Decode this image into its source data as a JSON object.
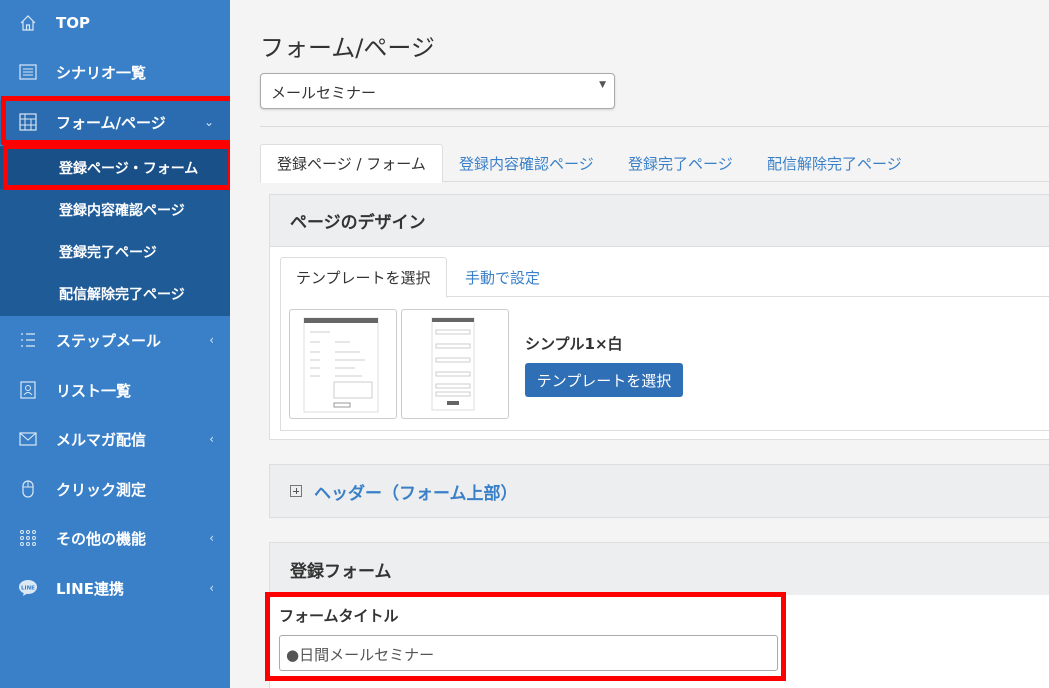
{
  "sidebar": {
    "items": [
      {
        "label": "TOP",
        "icon": "home-icon"
      },
      {
        "label": "シナリオ一覧",
        "icon": "list-icon"
      },
      {
        "label": "フォーム/ページ",
        "icon": "form-grid-icon",
        "chevron": "⌄"
      },
      {
        "label": "ステップメール",
        "icon": "steps-icon",
        "chevron": "‹"
      },
      {
        "label": "リスト一覧",
        "icon": "contacts-icon"
      },
      {
        "label": "メルマガ配信",
        "icon": "envelope-icon",
        "chevron": "‹"
      },
      {
        "label": "クリック測定",
        "icon": "mouse-icon"
      },
      {
        "label": "その他の機能",
        "icon": "dots-grid-icon",
        "chevron": "‹"
      },
      {
        "label": "LINE連携",
        "icon": "line-icon",
        "icon_text": "LINE",
        "chevron": "‹"
      }
    ],
    "submenu": [
      {
        "label": "登録ページ・フォーム"
      },
      {
        "label": "登録内容確認ページ"
      },
      {
        "label": "登録完了ページ"
      },
      {
        "label": "配信解除完了ページ"
      }
    ]
  },
  "main": {
    "title": "フォーム/ページ",
    "select_value": "メールセミナー",
    "tabs": [
      {
        "label": "登録ページ / フォーム"
      },
      {
        "label": "登録内容確認ページ"
      },
      {
        "label": "登録完了ページ"
      },
      {
        "label": "配信解除完了ページ"
      }
    ],
    "design_panel": {
      "title": "ページのデザイン",
      "tabs": [
        {
          "label": "テンプレートを選択"
        },
        {
          "label": "手動で設定"
        }
      ],
      "template_name": "シンプル1×白",
      "select_button": "テンプレートを選択"
    },
    "header_panel": {
      "title": "ヘッダー（フォーム上部）"
    },
    "form_panel": {
      "title": "登録フォーム",
      "field_label": "フォームタイトル",
      "field_value": "●日間メールセミナー"
    }
  },
  "colors": {
    "sidebar": "#3a80c9",
    "submenu": "#1e5b97",
    "accent": "#3a80c9",
    "primary_button": "#2f6fb5",
    "highlight": "#ff0000"
  }
}
